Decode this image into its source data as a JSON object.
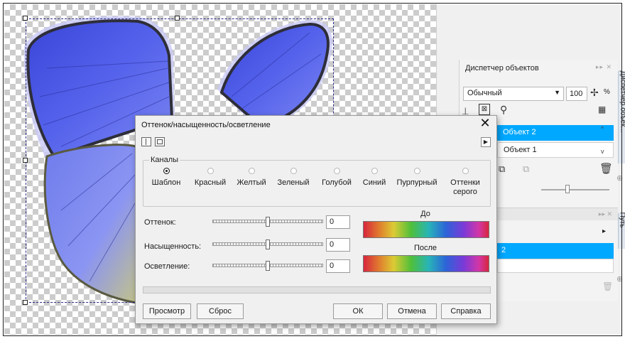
{
  "docker": {
    "title": "Диспетчер объектов",
    "mode": "Обычный",
    "opacity": "100",
    "opacity_unit": "%",
    "objects": [
      {
        "label": "Объект 2",
        "selected": true
      },
      {
        "label": "Объект 1",
        "selected": false
      }
    ],
    "side_tab": "Диспетчер объек...",
    "side_tab2": "Путь",
    "panel2_selected": "2"
  },
  "dialog": {
    "title": "Оттенок/насыщенность/осветление",
    "channels_group": "Каналы",
    "channels": [
      {
        "label": "Шаблон",
        "checked": true
      },
      {
        "label": "Красный",
        "checked": false
      },
      {
        "label": "Желтый",
        "checked": false
      },
      {
        "label": "Зеленый",
        "checked": false
      },
      {
        "label": "Голубой",
        "checked": false
      },
      {
        "label": "Синий",
        "checked": false
      },
      {
        "label": "Пурпурный",
        "checked": false
      },
      {
        "label": "Оттенки серого",
        "checked": false
      }
    ],
    "hue_label": "Оттенок:",
    "hue_value": "0",
    "saturation_label": "Насыщенность:",
    "saturation_value": "0",
    "lightness_label": "Осветление:",
    "lightness_value": "0",
    "before_label": "До",
    "after_label": "После",
    "preview_button": "Просмотр",
    "reset_button": "Сброс",
    "ok_button": "ОК",
    "cancel_button": "Отмена",
    "help_button": "Справка"
  },
  "colors": {
    "selection_blue": "#00a8ff",
    "butterfly_blue": "#4b57e6"
  }
}
